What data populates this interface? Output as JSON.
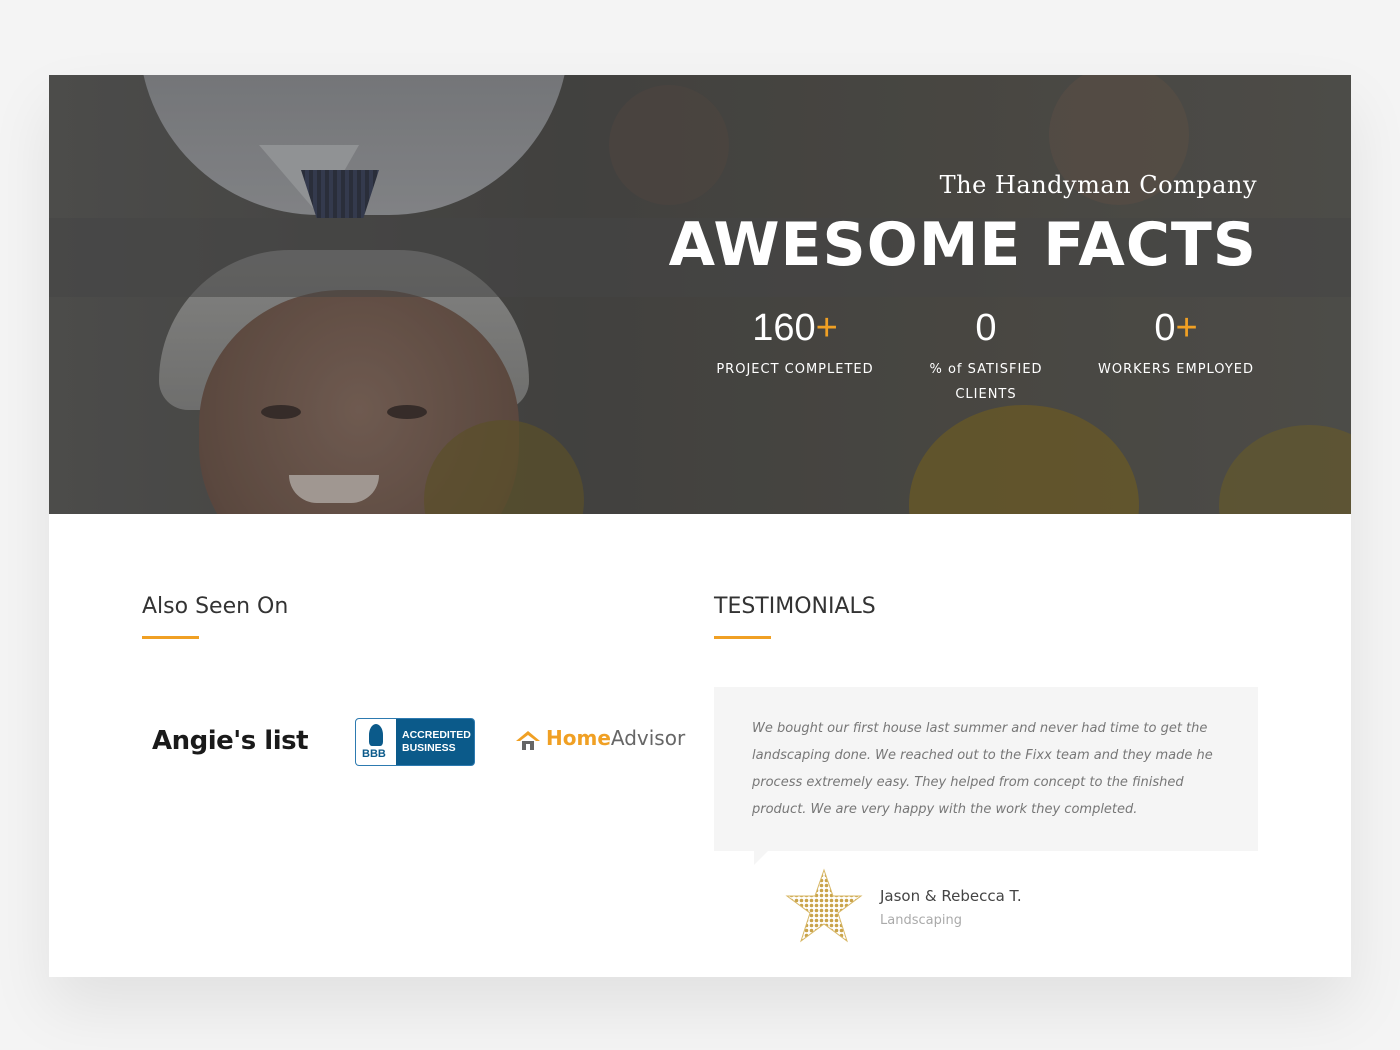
{
  "hero": {
    "subtitle": "The Handyman Company",
    "title": "AWESOME FACTS",
    "stats": [
      {
        "value": "160",
        "suffix": "+",
        "label": "PROJECT COMPLETED"
      },
      {
        "value": "0",
        "suffix": "",
        "label_line1": "% of SATISFIED",
        "label_line2": "CLIENTS"
      },
      {
        "value": "0",
        "suffix": "+",
        "label": "WORKERS EMPLOYED"
      }
    ]
  },
  "also_seen_on": {
    "title": "Also Seen On",
    "logos": {
      "angies": "Angie's list",
      "bbb_seal": "BBB",
      "bbb_line1": "ACCREDITED",
      "bbb_line2": "BUSINESS",
      "homeadvisor_home": "Home",
      "homeadvisor_advisor": "Advisor"
    }
  },
  "testimonials": {
    "title": "TESTIMONIALS",
    "quote": "We bought our first house last summer and never had time to get the landscaping done. We reached out to the Fixx team and they made he process extremely easy. They helped from concept to the finished product. We are very happy with the work they completed.",
    "author": "Jason & Rebecca T.",
    "role": "Landscaping"
  },
  "colors": {
    "accent": "#f0a024",
    "bbb_blue": "#0b5a8a",
    "quote_bg": "#f5f5f5"
  },
  "icons": [
    "home-advisor-house-icon",
    "star-icon",
    "bbb-torch-icon"
  ]
}
